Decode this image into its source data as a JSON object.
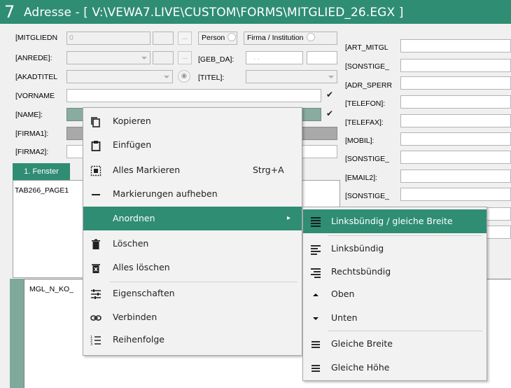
{
  "window": {
    "logo": "7",
    "title": "Adresse - [ V:\\VEWA7.LIVE\\CUSTOM\\FORMS\\MITGLIED_26.EGX ]"
  },
  "form": {
    "mitgliedn_label": "[MITGLIEDN",
    "mitgliedn_value": "0",
    "person_label": "Person",
    "firma_label": "Firma / Institution",
    "anrede_label": "[ANREDE]:",
    "geb_label": "[GEB_DA]:",
    "geb_value": ". .",
    "akadtitel_label": "[AKADTITEL",
    "titel_label": "[TITEL]:",
    "vorname_label": "[VORNAME",
    "name_label": "[NAME]:",
    "firma1_label": "[FIRMA1]:",
    "firma2_label": "[FIRMA2]:",
    "dots": "...",
    "check": "✔",
    "right_labels": [
      "[ART_MITGL",
      "[SONSTIGE_",
      "[ADR_SPERR",
      "[TELEFON]:",
      "[TELEFAX]:",
      "[MOBIL]:",
      "[SONSTIGE_",
      "[EMAIL2]:",
      "[SONSTIGE_"
    ]
  },
  "tabs": {
    "tab1_label": "1. Fenster",
    "page_label": "TAB266_PAGE1"
  },
  "lower": {
    "label": "MGL_N_KO_"
  },
  "context_menu": {
    "items": [
      {
        "icon": "copy-icon",
        "label": "Kopieren"
      },
      {
        "icon": "paste-icon",
        "label": "Einfügen"
      },
      {
        "icon": "select-all-icon",
        "label": "Alles Markieren",
        "shortcut": "Strg+A"
      },
      {
        "icon": "minus-icon",
        "label": "Markierungen aufheben"
      },
      {
        "icon": "",
        "label": "Anordnen",
        "submenu_arrow": "▸"
      },
      {
        "icon": "trash-icon",
        "label": "Löschen"
      },
      {
        "icon": "trash-x-icon",
        "label": "Alles löschen"
      },
      {
        "icon": "sliders-icon",
        "label": "Eigenschaften"
      },
      {
        "icon": "link-icon",
        "label": "Verbinden"
      },
      {
        "icon": "order-icon",
        "label": "Reihenfolge"
      }
    ]
  },
  "submenu": {
    "items": [
      {
        "icon": "align-justify-icon",
        "label": "Linksbündig / gleiche Breite"
      },
      {
        "icon": "align-left-icon",
        "label": "Linksbündig"
      },
      {
        "icon": "align-right-icon",
        "label": "Rechtsbündig"
      },
      {
        "icon": "caret-up-icon",
        "label": "Oben"
      },
      {
        "icon": "caret-down-icon",
        "label": "Unten"
      },
      {
        "icon": "equal-width-icon",
        "label": "Gleiche Breite"
      },
      {
        "icon": "equal-height-icon",
        "label": "Gleiche Höhe"
      }
    ]
  },
  "colors": {
    "accent": "#2f8d74"
  }
}
